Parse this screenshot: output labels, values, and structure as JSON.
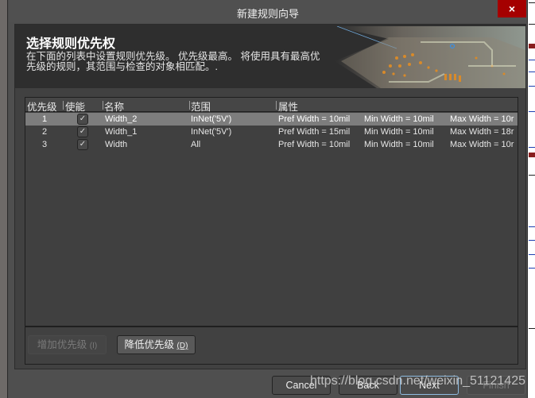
{
  "window": {
    "title": "新建规则向导",
    "close_icon": "×"
  },
  "banner": {
    "title": "选择规则优先权",
    "description": "在下面的列表中设置规则优先级。 优先级最高。 将使用具有最高优先级的规则，其范围与检查的对象相匹配。."
  },
  "table": {
    "columns": [
      "优先级",
      "使能",
      "名称",
      "范围",
      "属性"
    ],
    "rows": [
      {
        "priority": "1",
        "enabled": true,
        "name": "Width_2",
        "scope": "InNet('5V')",
        "pref": "Pref Width = 10mil",
        "min": "Min Width = 10mil",
        "max": "Max Width = 10r",
        "selected": true
      },
      {
        "priority": "2",
        "enabled": true,
        "name": "Width_1",
        "scope": "InNet('5V')",
        "pref": "Pref Width = 15mil",
        "min": "Min Width = 10mil",
        "max": "Max Width = 18r",
        "selected": false
      },
      {
        "priority": "3",
        "enabled": true,
        "name": "Width",
        "scope": "All",
        "pref": "Pref Width = 10mil",
        "min": "Min Width = 10mil",
        "max": "Max Width = 10r",
        "selected": false
      }
    ],
    "check_glyph": "✓"
  },
  "priority_buttons": {
    "increase": {
      "label": "增加优先级",
      "hotkey": "(I)"
    },
    "decrease": {
      "label": "降低优先级",
      "hotkey": "(D)"
    }
  },
  "footer": {
    "cancel": "Cancel",
    "back": "Back",
    "next": "Next",
    "finish": "Finish"
  },
  "watermark": "https://blog.csdn.net/weixin_51121425"
}
